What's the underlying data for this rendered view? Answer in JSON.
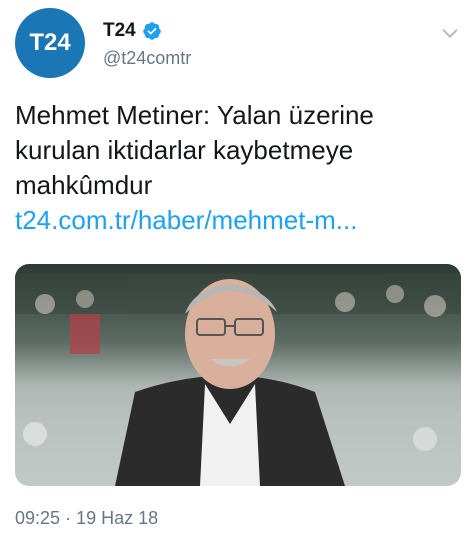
{
  "header": {
    "avatar_text": "T24",
    "display_name": "T24",
    "handle": "@t24comtr"
  },
  "tweet": {
    "text_lines": [
      "Mehmet Metiner: Yalan üzerine",
      "kurulan iktidarlar kaybetmeye",
      "mahkûmdur"
    ],
    "link": "t24.com.tr/haber/mehmet-m..."
  },
  "meta": {
    "time": "09:25",
    "date": "19 Haz 18"
  },
  "colors": {
    "avatar": "#1b76b6",
    "link": "#1da1f2",
    "muted": "#657786",
    "verified": "#1da1f2"
  }
}
